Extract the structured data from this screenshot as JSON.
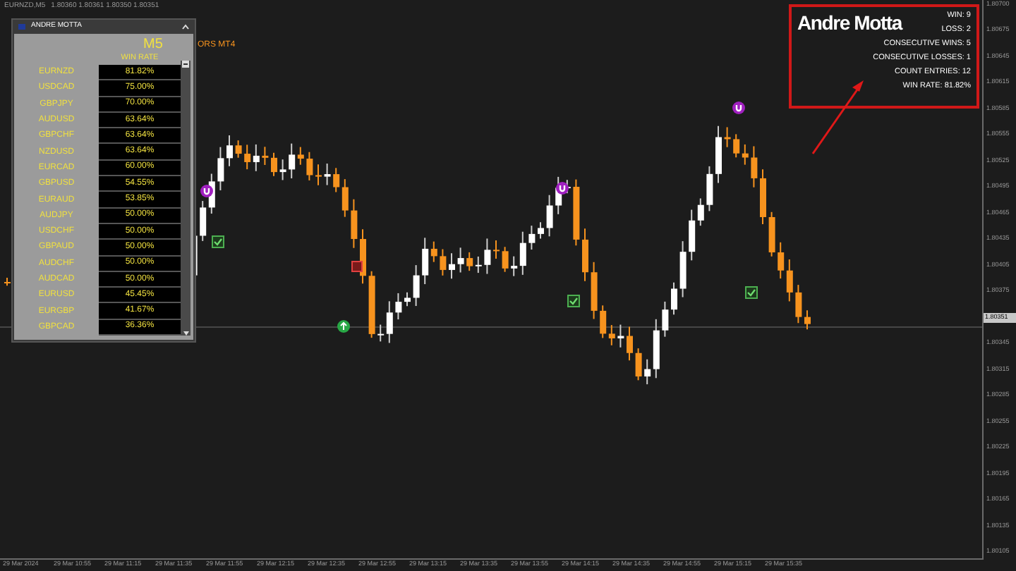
{
  "header": {
    "symbol": "EURNZD,M5",
    "prices": "1.80360 1.80361 1.80350 1.80351"
  },
  "indicator_label": "ORS MT4",
  "panel": {
    "title": "ANDRE MOTTA",
    "timeframe": "M5",
    "column": "WIN RATE",
    "rows": [
      {
        "pair": "EURNZD",
        "rate": "81.82%"
      },
      {
        "pair": "USDCAD",
        "rate": "75.00%"
      },
      {
        "pair": "GBPJPY",
        "rate": "70.00%"
      },
      {
        "pair": "AUDUSD",
        "rate": "63.64%"
      },
      {
        "pair": "GBPCHF",
        "rate": "63.64%"
      },
      {
        "pair": "NZDUSD",
        "rate": "63.64%"
      },
      {
        "pair": "EURCAD",
        "rate": "60.00%"
      },
      {
        "pair": "GBPUSD",
        "rate": "54.55%"
      },
      {
        "pair": "EURAUD",
        "rate": "53.85%"
      },
      {
        "pair": "AUDJPY",
        "rate": "50.00%"
      },
      {
        "pair": "USDCHF",
        "rate": "50.00%"
      },
      {
        "pair": "GBPAUD",
        "rate": "50.00%"
      },
      {
        "pair": "AUDCHF",
        "rate": "50.00%"
      },
      {
        "pair": "AUDCAD",
        "rate": "50.00%"
      },
      {
        "pair": "EURUSD",
        "rate": "45.45%"
      },
      {
        "pair": "EURGBP",
        "rate": "41.67%"
      },
      {
        "pair": "GBPCAD",
        "rate": "36.36%"
      }
    ]
  },
  "stats": {
    "name": "Andre Motta",
    "lines": [
      "WIN: 9",
      "LOSS: 2",
      "CONSECUTIVE WINS: 5",
      "CONSECUTIVE LOSSES: 1",
      "COUNT ENTRIES: 12",
      "WIN RATE: 81.82%"
    ]
  },
  "price_axis": [
    {
      "text": "1.80700",
      "kind": "tick"
    },
    {
      "text": "1.80675",
      "kind": "tick"
    },
    {
      "text": "1.80645",
      "kind": "tick"
    },
    {
      "text": "1.80615",
      "kind": "tick"
    },
    {
      "text": "1.80585",
      "kind": "tick"
    },
    {
      "text": "1.80555",
      "kind": "tick"
    },
    {
      "text": "1.80525",
      "kind": "tick"
    },
    {
      "text": "1.80495",
      "kind": "tick"
    },
    {
      "text": "1.80465",
      "kind": "tick"
    },
    {
      "text": "1.80435",
      "kind": "tick"
    },
    {
      "text": "1.80405",
      "kind": "tick"
    },
    {
      "text": "1.80375",
      "kind": "tick"
    },
    {
      "text": "1.80351",
      "kind": "current"
    },
    {
      "text": "1.80345",
      "kind": "tick"
    },
    {
      "text": "1.80315",
      "kind": "tick"
    },
    {
      "text": "1.80285",
      "kind": "tick"
    },
    {
      "text": "1.80255",
      "kind": "tick"
    },
    {
      "text": "1.80225",
      "kind": "tick"
    },
    {
      "text": "1.80195",
      "kind": "tick"
    },
    {
      "text": "1.80165",
      "kind": "tick"
    },
    {
      "text": "1.80135",
      "kind": "tick"
    },
    {
      "text": "1.80105",
      "kind": "tick"
    }
  ],
  "time_axis": [
    "29 Mar 2024",
    "29 Mar 10:55",
    "29 Mar 11:15",
    "29 Mar 11:35",
    "29 Mar 11:55",
    "29 Mar 12:15",
    "29 Mar 12:35",
    "29 Mar 12:55",
    "29 Mar 13:15",
    "29 Mar 13:35",
    "29 Mar 13:55",
    "29 Mar 14:15",
    "29 Mar 14:35",
    "29 Mar 14:55",
    "29 Mar 15:15",
    "29 Mar 15:35"
  ]
}
